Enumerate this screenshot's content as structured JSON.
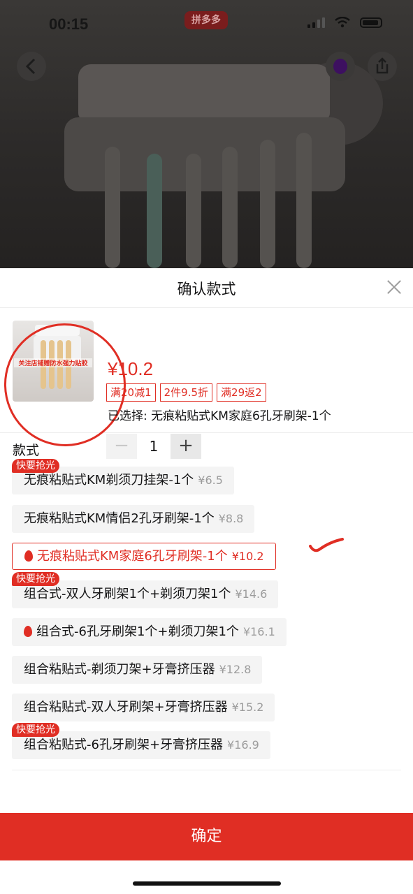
{
  "status_bar": {
    "time": "00:15",
    "app_badge": "拼多多"
  },
  "sheet": {
    "title": "确认款式",
    "product": {
      "price": "¥10.2",
      "thumbnail_caption": "关注店铺赠防水强力贴胶",
      "promo_tags": [
        "满20减1",
        "2件9.5折",
        "满29返2"
      ],
      "selected_prefix": "已选择: ",
      "selected_value": "无痕粘贴式KM家庭6孔牙刷架-1个",
      "quantity": "1",
      "minus": "−",
      "plus": "+"
    },
    "options_label": "款式",
    "hot_badge": "快要抢光",
    "options": [
      {
        "name": "无痕粘贴式KM剃须刀挂架-1个",
        "price": "¥6.5"
      },
      {
        "name": "无痕粘贴式KM情侣2孔牙刷架-1个",
        "price": "¥8.8"
      },
      {
        "name": "无痕粘贴式KM家庭6孔牙刷架-1个",
        "price": "¥10.2"
      },
      {
        "name": "组合式-双人牙刷架1个+剃须刀架1个",
        "price": "¥14.6"
      },
      {
        "name": "组合式-6孔牙刷架1个+剃须刀架1个",
        "price": "¥16.1"
      },
      {
        "name": "组合粘贴式-剃须刀架+牙膏挤压器",
        "price": "¥12.8"
      },
      {
        "name": "组合粘贴式-双人牙刷架+牙膏挤压器",
        "price": "¥15.2"
      },
      {
        "name": "组合粘贴式-6孔牙刷架+牙膏挤压器",
        "price": "¥16.9"
      }
    ],
    "confirm_label": "确定"
  },
  "colors": {
    "accent": "#e02e24",
    "chip_bg": "#f4f4f4",
    "muted_price": "#9c9c9c"
  },
  "icons": [
    "back-icon",
    "share-icon",
    "close-icon",
    "flame-icon",
    "signal-icon",
    "wifi-icon",
    "battery-icon"
  ]
}
